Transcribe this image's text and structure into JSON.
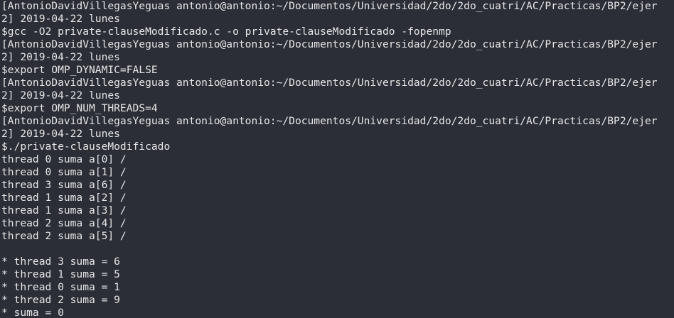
{
  "terminal": {
    "lines": [
      "[AntonioDavidVillegasYeguas antonio@antonio:~/Documentos/Universidad/2do/2do_cuatri/AC/Practicas/BP2/ejer",
      "2] 2019-04-22 lunes",
      "$gcc -O2 private-clauseModificado.c -o private-clauseModificado -fopenmp",
      "[AntonioDavidVillegasYeguas antonio@antonio:~/Documentos/Universidad/2do/2do_cuatri/AC/Practicas/BP2/ejer",
      "2] 2019-04-22 lunes",
      "$export OMP_DYNAMIC=FALSE",
      "[AntonioDavidVillegasYeguas antonio@antonio:~/Documentos/Universidad/2do/2do_cuatri/AC/Practicas/BP2/ejer",
      "2] 2019-04-22 lunes",
      "$export OMP_NUM_THREADS=4",
      "[AntonioDavidVillegasYeguas antonio@antonio:~/Documentos/Universidad/2do/2do_cuatri/AC/Practicas/BP2/ejer",
      "2] 2019-04-22 lunes",
      "$./private-clauseModificado",
      "thread 0 suma a[0] /",
      "thread 0 suma a[1] /",
      "thread 3 suma a[6] /",
      "thread 1 suma a[2] /",
      "thread 1 suma a[3] /",
      "thread 2 suma a[4] /",
      "thread 2 suma a[5] /",
      "",
      "* thread 3 suma = 6",
      "* thread 1 suma = 5",
      "* thread 0 suma = 1",
      "* thread 2 suma = 9",
      "* suma = 0"
    ]
  },
  "colors": {
    "background": "#2b2e36",
    "text": "#e6e6e6"
  }
}
